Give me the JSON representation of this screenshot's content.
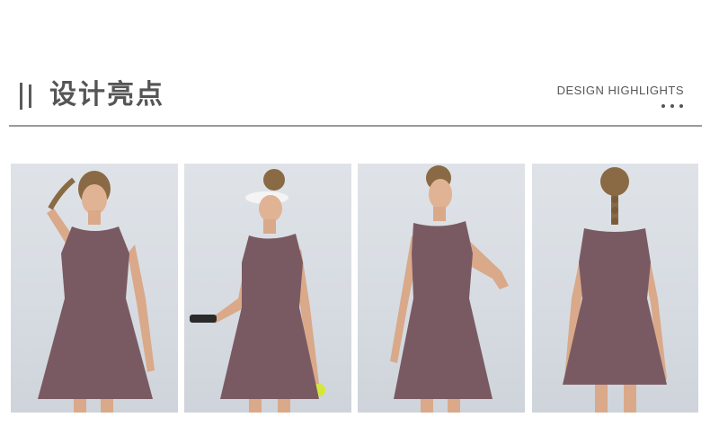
{
  "header": {
    "title_cn": "设计亮点",
    "title_en": "DESIGN HIGHLIGHTS"
  },
  "photos": [
    {
      "subject": "woman-front-view-dress"
    },
    {
      "subject": "woman-with-visor-racket-ball"
    },
    {
      "subject": "woman-three-quarter-pose"
    },
    {
      "subject": "woman-back-view-braid"
    }
  ],
  "colors": {
    "dress": "#7a5a62",
    "skin": "#d9a98a",
    "hair": "#8a6a44",
    "accent_text": "#555555"
  }
}
